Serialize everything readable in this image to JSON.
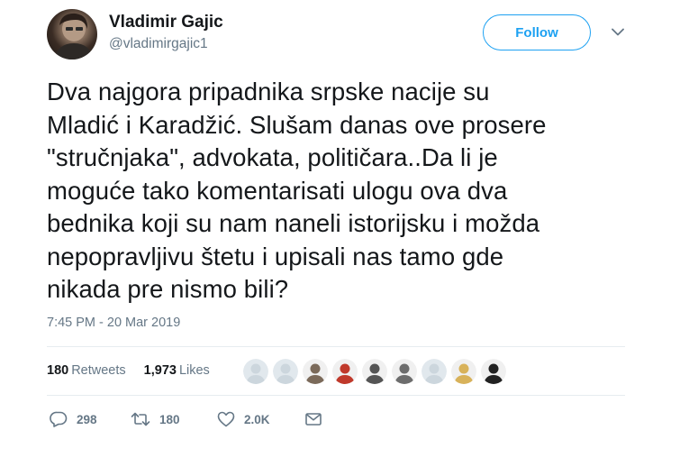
{
  "user": {
    "name": "Vladimir Gajic",
    "handle": "@vladimirgajic1",
    "avatar_icon": "profile-photo"
  },
  "follow_label": "Follow",
  "tweet": {
    "lines": [
      "Dva najgora pripadnika srpske nacije su",
      "Mladić i Karadžić. Slušam danas ove prosere",
      "\"stručnjaka\", advokata, političara..Da li je",
      "moguće tako komentarisati ulogu ova dva",
      "bednika koji su nam naneli istorijsku i možda",
      "nepopravljivu štetu i upisali nas tamo gde",
      "nikada pre nismo bili?"
    ],
    "timestamp": "7:45 PM - 20 Mar 2019"
  },
  "stats": {
    "retweets_count": "180",
    "retweets_label": "Retweets",
    "likes_count": "1,973",
    "likes_label": "Likes"
  },
  "likers": [
    {
      "icon": "default-avatar-icon",
      "color": "#ccd6dd"
    },
    {
      "icon": "default-avatar-icon",
      "color": "#ccd6dd"
    },
    {
      "icon": "user-photo-icon",
      "color": "#7b6a5a"
    },
    {
      "icon": "user-photo-icon",
      "color": "#c0392b"
    },
    {
      "icon": "user-photo-icon",
      "color": "#555555"
    },
    {
      "icon": "user-photo-icon",
      "color": "#6d6d6d"
    },
    {
      "icon": "default-avatar-icon",
      "color": "#ccd6dd"
    },
    {
      "icon": "user-photo-icon",
      "color": "#d8b25a"
    },
    {
      "icon": "user-photo-icon",
      "color": "#222222"
    }
  ],
  "actions": {
    "reply_count": "298",
    "retweet_count": "180",
    "like_count": "2.0K"
  },
  "colors": {
    "accent": "#1da1f2",
    "text": "#14171a",
    "muted": "#657786",
    "divider": "#e6ecf0"
  }
}
